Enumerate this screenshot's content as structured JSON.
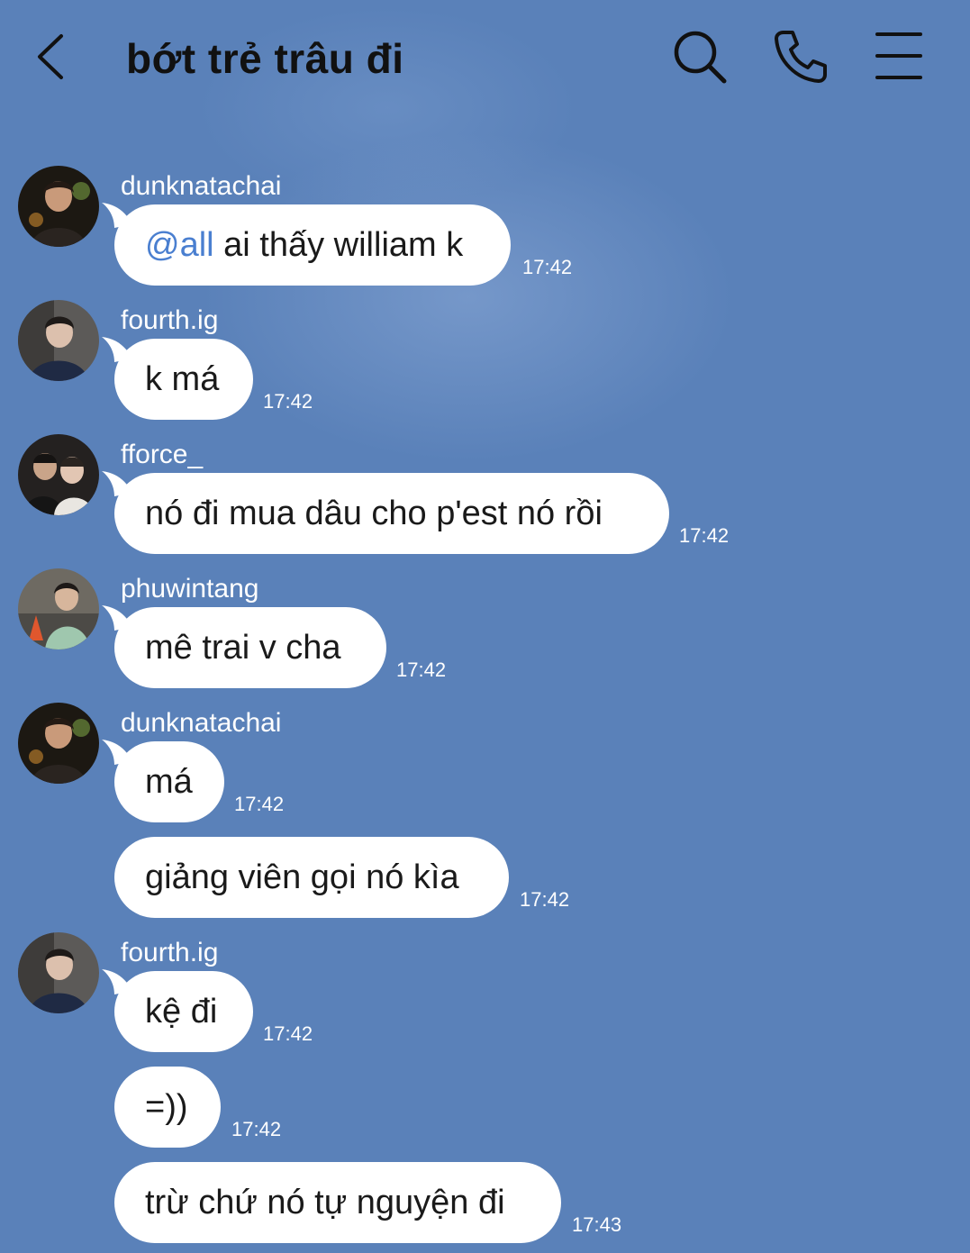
{
  "header": {
    "title": "bớt trẻ trâu đi",
    "back_icon": "chevron-left-icon",
    "search_icon": "search-icon",
    "call_icon": "phone-icon",
    "menu_icon": "menu-icon"
  },
  "colors": {
    "background": "#5a81b9",
    "bubble": "#ffffff",
    "mention": "#4a7fd0"
  },
  "messages": [
    {
      "sender": "dunknatachai",
      "mention": "@all",
      "text": " ai thấy william k",
      "time": "17:42"
    },
    {
      "sender": "fourth.ig",
      "text": "k má",
      "time": "17:42"
    },
    {
      "sender": "fforce_",
      "text": "nó đi mua dâu cho p'est nó rồi",
      "time": "17:42"
    },
    {
      "sender": "phuwintang",
      "text": "mê trai v cha",
      "time": "17:42"
    },
    {
      "sender": "dunknatachai",
      "text": "má",
      "time": "17:42"
    },
    {
      "text": "giảng viên gọi nó kìa",
      "time": "17:42"
    },
    {
      "sender": "fourth.ig",
      "text": "kệ đi",
      "time": "17:42"
    },
    {
      "text": "=))",
      "time": "17:42"
    },
    {
      "text": "trừ chứ nó tự nguyện đi",
      "time": "17:43"
    }
  ]
}
